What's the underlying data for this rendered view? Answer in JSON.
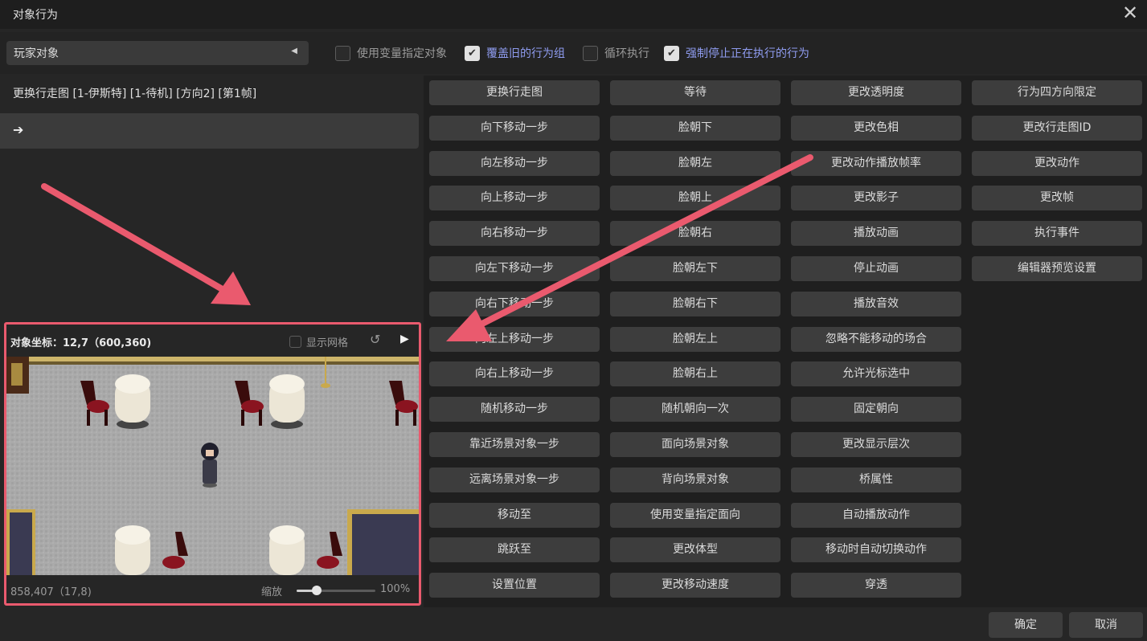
{
  "window": {
    "title": "对象行为",
    "close_icon": "✕"
  },
  "options": {
    "target_value": "玩家对象",
    "dropdown_arrow": "◀",
    "checkboxes": [
      {
        "label": "使用变量指定对象",
        "checked": false
      },
      {
        "label": "覆盖旧的行为组",
        "checked": true
      },
      {
        "label": "循环执行",
        "checked": false
      },
      {
        "label": "强制停止正在执行的行为",
        "checked": true
      }
    ]
  },
  "behavior_list": {
    "command_text": "更换行走图 [1-伊斯特] [1-待机] [方向2] [第1帧]",
    "cursor_arrow": "➔"
  },
  "preview": {
    "coord_label": "对象坐标：12,7（600,360)",
    "grid_label": "显示网格",
    "grid_checked": false,
    "reset_icon": "↺",
    "play_icon": "▶",
    "cursor_coord": "858,407（17,8)",
    "zoom_label": "缩放",
    "zoom_percent": 100,
    "zoom_value": "100%"
  },
  "commands": [
    [
      "更换行走图",
      "向下移动一步",
      "向左移动一步",
      "向上移动一步",
      "向右移动一步",
      "向左下移动一步",
      "向右下移动一步",
      "向左上移动一步",
      "向右上移动一步",
      "随机移动一步",
      "靠近场景对象一步",
      "远离场景对象一步",
      "移动至",
      "跳跃至",
      "设置位置"
    ],
    [
      "等待",
      "脸朝下",
      "脸朝左",
      "脸朝上",
      "脸朝右",
      "脸朝左下",
      "脸朝右下",
      "脸朝左上",
      "脸朝右上",
      "随机朝向一次",
      "面向场景对象",
      "背向场景对象",
      "使用变量指定面向",
      "更改体型",
      "更改移动速度"
    ],
    [
      "更改透明度",
      "更改色相",
      "更改动作播放帧率",
      "更改影子",
      "播放动画",
      "停止动画",
      "播放音效",
      "忽略不能移动的场合",
      "允许光标选中",
      "固定朝向",
      "更改显示层次",
      "桥属性",
      "自动播放动作",
      "移动时自动切换动作",
      "穿透"
    ],
    [
      "行为四方向限定",
      "更改行走图ID",
      "更改动作",
      "更改帧",
      "执行事件",
      "编辑器预览设置"
    ]
  ],
  "footer": {
    "ok_label": "确定",
    "cancel_label": "取消"
  },
  "colors": {
    "highlight": "#ea5a6e",
    "checked_label": "#8f9cf0",
    "button_bg": "#3d3d3d"
  }
}
